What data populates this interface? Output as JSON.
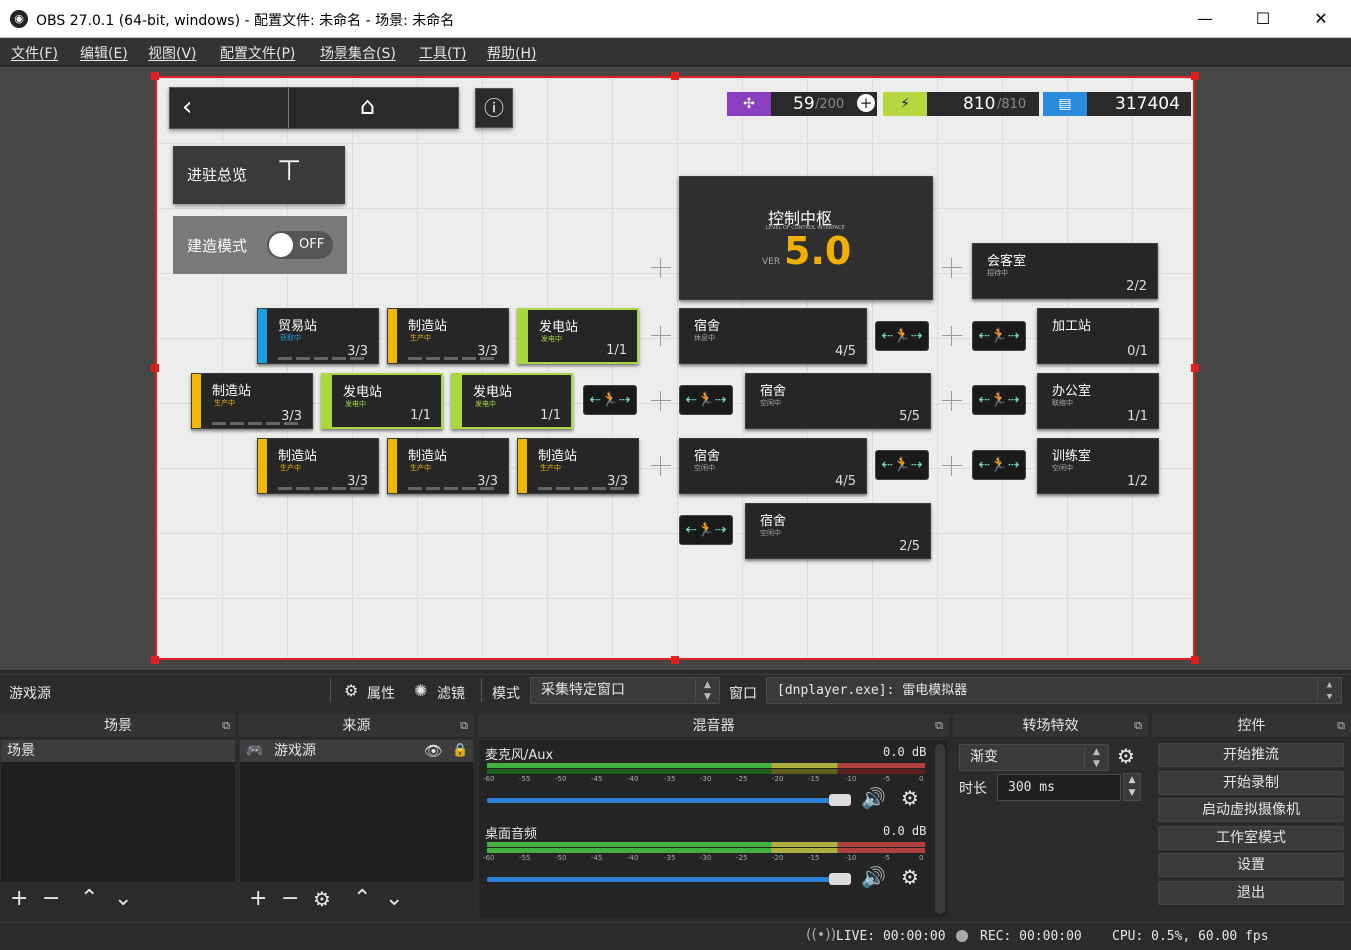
{
  "window": {
    "title": "OBS 27.0.1 (64-bit, windows) - 配置文件: 未命名 - 场景: 未命名",
    "minimize": "—",
    "maximize": "☐",
    "close": "✕"
  },
  "menu": [
    "文件(F)",
    "编辑(E)",
    "视图(V)",
    "配置文件(P)",
    "场景集合(S)",
    "工具(T)",
    "帮助(H)"
  ],
  "game": {
    "drone": "59",
    "drone_max": "/200",
    "power": "810",
    "power_max": "/810",
    "currency": "317404",
    "overview": "进驻总览",
    "build_mode": "建造模式",
    "build_toggle": "OFF",
    "control": {
      "name": "控制中枢",
      "sub": "LEVEL OF CONTROL INTERFACE",
      "ver": "VER",
      "level": "5.0"
    },
    "rooms": [
      {
        "name": "会客室",
        "status": "招待中",
        "count": "2/2"
      },
      {
        "name": "贸易站",
        "status": "获取中",
        "count": "3/3"
      },
      {
        "name": "制造站",
        "status": "生产中",
        "count": "3/3"
      },
      {
        "name": "发电站",
        "status": "发电中",
        "count": "1/1"
      },
      {
        "name": "宿舍",
        "status": "休息中",
        "count": "4/5"
      },
      {
        "name": "加工站",
        "status": "",
        "count": "0/1"
      },
      {
        "name": "制造站",
        "status": "生产中",
        "count": "3/3"
      },
      {
        "name": "发电站",
        "status": "发电中",
        "count": "1/1"
      },
      {
        "name": "发电站",
        "status": "发电中",
        "count": "1/1"
      },
      {
        "name": "宿舍",
        "status": "空闲中",
        "count": "5/5"
      },
      {
        "name": "办公室",
        "status": "联络中",
        "count": "1/1"
      },
      {
        "name": "制造站",
        "status": "生产中",
        "count": "3/3"
      },
      {
        "name": "制造站",
        "status": "生产中",
        "count": "3/3"
      },
      {
        "name": "制造站",
        "status": "生产中",
        "count": "3/3"
      },
      {
        "name": "宿舍",
        "status": "空闲中",
        "count": "4/5"
      },
      {
        "name": "训练室",
        "status": "空闲中",
        "count": "1/2"
      },
      {
        "name": "宿舍",
        "status": "空闲中",
        "count": "2/5"
      }
    ]
  },
  "props": {
    "source": "游戏源",
    "properties": "属性",
    "filters": "滤镜",
    "mode_label": "模式",
    "mode_value": "采集特定窗口",
    "window_label": "窗口",
    "window_value": "[dnplayer.exe]: 雷电模拟器"
  },
  "docks": {
    "scenes": {
      "title": "场景",
      "items": [
        "场景"
      ]
    },
    "sources": {
      "title": "来源",
      "items": [
        "游戏源"
      ]
    },
    "mixer": {
      "title": "混音器",
      "tracks": [
        {
          "name": "麦克风/Aux",
          "db": "0.0 dB"
        },
        {
          "name": "桌面音频",
          "db": "0.0 dB"
        }
      ],
      "ticks": [
        "-60",
        "-55",
        "-50",
        "-45",
        "-40",
        "-35",
        "-30",
        "-25",
        "-20",
        "-15",
        "-10",
        "-5",
        "0"
      ]
    },
    "transitions": {
      "title": "转场特效",
      "type": "渐变",
      "duration_label": "时长",
      "duration": "300 ms"
    },
    "controls": {
      "title": "控件",
      "buttons": [
        "开始推流",
        "开始录制",
        "启动虚拟摄像机",
        "工作室模式",
        "设置",
        "退出"
      ]
    }
  },
  "status": {
    "live": "LIVE: 00:00:00",
    "rec": "REC: 00:00:00",
    "cpu": "CPU: 0.5%, 60.00 fps"
  }
}
